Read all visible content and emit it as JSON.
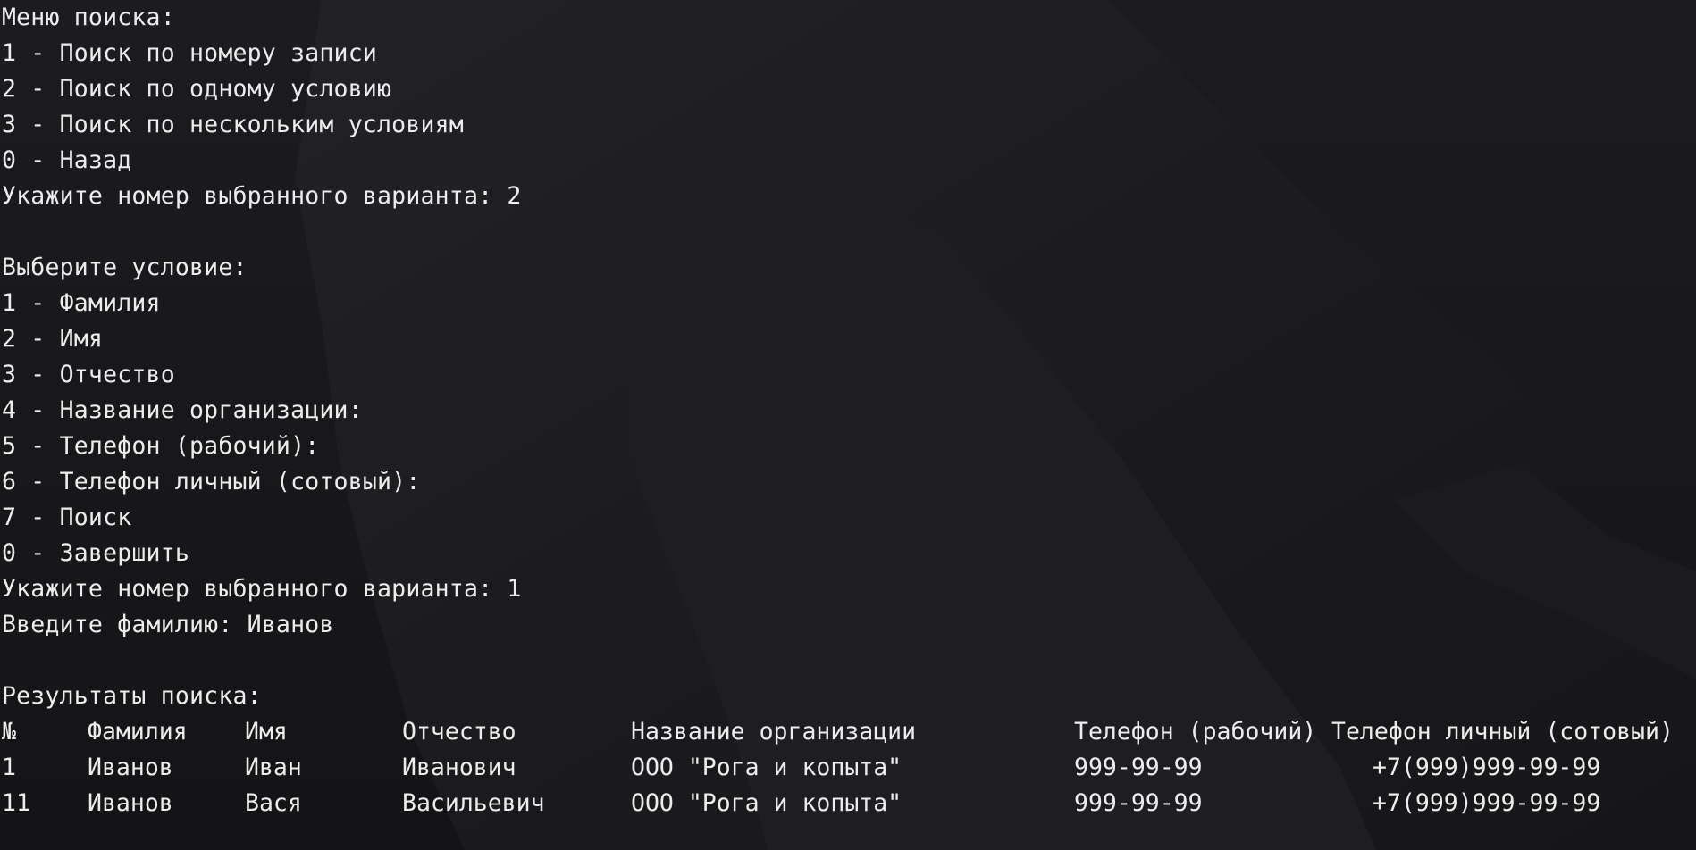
{
  "terminal": {
    "search_menu": {
      "title": "Меню поиска:",
      "options": [
        "1 - Поиск по номеру записи",
        "2 - Поиск по одному условию",
        "3 - Поиск по нескольким условиям",
        "0 - Назад"
      ],
      "prompt": "Укажите номер выбранного варианта: 2"
    },
    "condition_menu": {
      "title": "Выберите условие:",
      "options": [
        "1 - Фамилия",
        "2 - Имя",
        "3 - Отчество",
        "4 - Название организации:",
        "5 - Телефон (рабочий):",
        "6 - Телефон личный (сотовый):",
        "7 - Поиск",
        "0 - Завершить"
      ],
      "prompt": "Укажите номер выбранного варианта: 1",
      "input_prompt": "Введите фамилию: Иванов"
    },
    "results": {
      "title": "Результаты поиска:",
      "headers": [
        "№",
        "Фамилия",
        "Имя",
        "Отчество",
        "Название организации",
        "Телефон (рабочий)",
        "Телефон личный (сотовый)"
      ],
      "rows": [
        [
          "1",
          "Иванов",
          "Иван",
          "Иванович",
          "ООО \"Рога и копыта\"",
          "999-99-99",
          "+7(999)999-99-99"
        ],
        [
          "11",
          "Иванов",
          "Вася",
          "Васильевич",
          "ООО \"Рога и копыта\"",
          "999-99-99",
          "+7(999)999-99-99"
        ]
      ]
    }
  },
  "colors": {
    "background": "#18181b",
    "text": "#ececec"
  }
}
